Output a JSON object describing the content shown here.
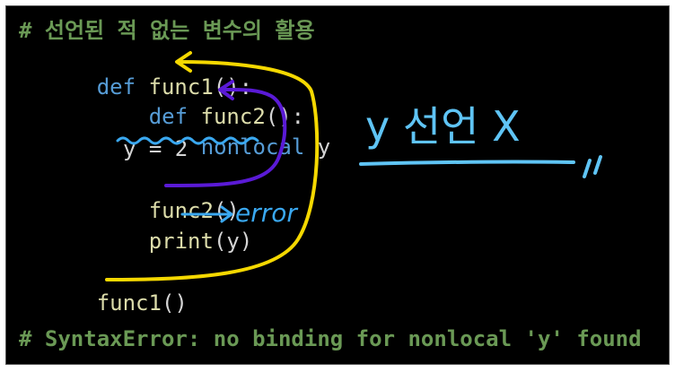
{
  "code": {
    "comment_top": "# 선언된 적 없는 변수의 활용",
    "l1_kw": "def",
    "l1_fn": "func1",
    "l1_rest": "():",
    "l2_kw": "def",
    "l2_fn": "func2",
    "l2_rest": "():",
    "l3_kw": "nonlocal",
    "l3_var": "y",
    "l4": "y = 2",
    "l5_fn": "func2",
    "l5_rest": "()",
    "l6_fn": "print",
    "l6_rest": "(y)",
    "l7_fn": "func1",
    "l7_rest": "()",
    "comment_bottom": "# SyntaxError: no binding for nonlocal 'y' found"
  },
  "annotations": {
    "error_label": "error",
    "handwritten_note": "y 선언 X",
    "colors": {
      "yellow": "#f5d800",
      "purple": "#5a1ad6",
      "blue": "#3aa8f0",
      "light_blue": "#5fc4f5"
    }
  }
}
